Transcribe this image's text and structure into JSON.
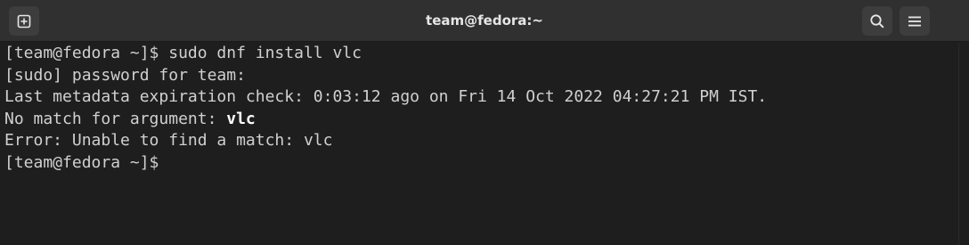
{
  "window": {
    "title": "team@fedora:~"
  },
  "toolbar": {
    "new_tab_icon": "new-tab-icon",
    "search_icon": "search-icon",
    "menu_icon": "hamburger-menu-icon"
  },
  "terminal": {
    "lines": [
      {
        "text": "[team@fedora ~]$ sudo dnf install vlc"
      },
      {
        "text": "[sudo] password for team:"
      },
      {
        "text": "Last metadata expiration check: 0:03:12 ago on Fri 14 Oct 2022 04:27:21 PM IST."
      },
      {
        "prefix": "No match for argument: ",
        "bold": "vlc"
      },
      {
        "text": "Error: Unable to find a match: vlc"
      },
      {
        "text": "[team@fedora ~]$ "
      }
    ]
  },
  "colors": {
    "background": "#1e1e1e",
    "titlebar": "#303030",
    "text": "#d0d0d0"
  }
}
